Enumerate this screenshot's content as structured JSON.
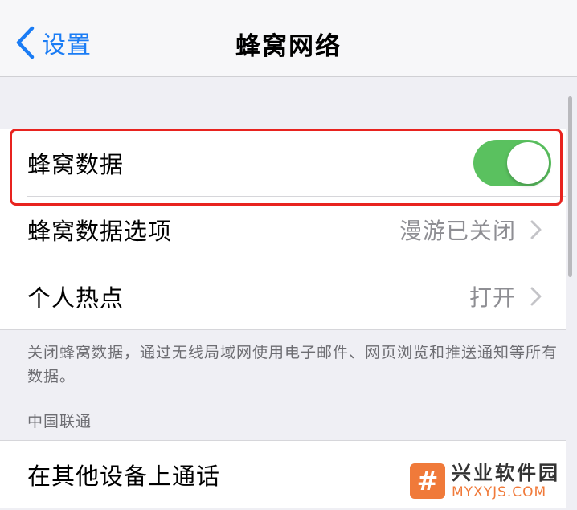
{
  "nav": {
    "back_label": "设置",
    "title": "蜂窝网络"
  },
  "group1": {
    "cellular_data": {
      "label": "蜂窝数据",
      "enabled": true
    },
    "cellular_options": {
      "label": "蜂窝数据选项",
      "value": "漫游已关闭"
    },
    "hotspot": {
      "label": "个人热点",
      "value": "打开"
    }
  },
  "footnote": "关闭蜂窝数据，通过无线局域网使用电子邮件、网页浏览和推送通知等所有数据。",
  "carrier_section": {
    "header": "中国联通",
    "items": [
      {
        "label": "在其他设备上通话"
      }
    ]
  },
  "watermark": {
    "logo_glyph": "#",
    "title": "兴业软件园",
    "domain": "MYXYJS.COM"
  },
  "colors": {
    "accent": "#1a7cf5",
    "toggle_on": "#5ac15f",
    "highlight": "#e8231f",
    "watermark": "#f07a3a"
  },
  "icons": {
    "back": "chevron-left-icon",
    "disclosure": "chevron-right-icon"
  }
}
